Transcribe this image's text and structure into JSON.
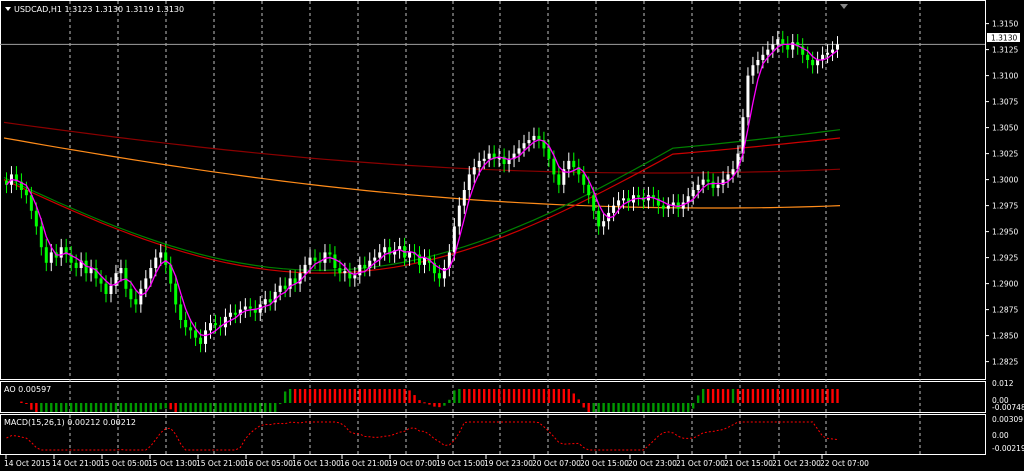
{
  "window": {
    "symbol_line": "USDCAD,H1  1.3123 1.3130 1.3119 1.3130",
    "current_price_label": "1.3130"
  },
  "colors": {
    "background": "#000000",
    "bull_candle": "#ffffff",
    "bear_candle": "#00ff00",
    "fast_ma": "#ff00ff",
    "ma_green": "#008000",
    "ma_red": "#cc0000",
    "ma_darkred": "#8b0000",
    "ma_orange": "#ff8c1a",
    "ao_up": "#009900",
    "ao_down": "#ff0000",
    "macd_signal": "#ff0000",
    "grid": "#c0c0c0"
  },
  "main_price_axis": [
    "1.3150",
    "1.3125",
    "1.3100",
    "1.3075",
    "1.3050",
    "1.3025",
    "1.3000",
    "1.2975",
    "1.2950",
    "1.2925",
    "1.2900",
    "1.2875",
    "1.2850",
    "1.2825"
  ],
  "ao_panel": {
    "label": "AO 0.00597",
    "axis": [
      "0.012",
      "0.00",
      "-0.00748"
    ]
  },
  "macd_panel": {
    "label": "MACD(15,26,1) 0.00212 0.00212",
    "axis": [
      "0.00309",
      "0.00",
      "-0.00219"
    ]
  },
  "time_axis": [
    "14 Oct 2015",
    "14 Oct 21:00",
    "15 Oct 05:00",
    "15 Oct 13:00",
    "15 Oct 21:00",
    "16 Oct 05:00",
    "16 Oct 13:00",
    "16 Oct 21:00",
    "19 Oct 07:00",
    "19 Oct 15:00",
    "19 Oct 23:00",
    "20 Oct 07:00",
    "20 Oct 15:00",
    "20 Oct 23:00",
    "21 Oct 07:00",
    "21 Oct 15:00",
    "21 Oct 23:00",
    "22 Oct 07:00"
  ],
  "chart_data": {
    "type": "candlestick",
    "symbol": "USDCAD",
    "timeframe": "H1",
    "ylim": [
      1.2815,
      1.3165
    ],
    "close_series": [
      1.2995,
      1.3005,
      1.2998,
      1.299,
      1.2985,
      1.297,
      1.2955,
      1.2935,
      1.292,
      1.293,
      1.2925,
      1.2935,
      1.2928,
      1.292,
      1.2915,
      1.2922,
      1.291,
      1.2915,
      1.2905,
      1.29,
      1.289,
      1.2898,
      1.291,
      1.2915,
      1.2895,
      1.2885,
      1.288,
      1.2895,
      1.2905,
      1.2915,
      1.2925,
      1.293,
      1.2918,
      1.29,
      1.288,
      1.2865,
      1.2858,
      1.2855,
      1.2848,
      1.2842,
      1.2855,
      1.2862,
      1.286,
      1.2858,
      1.2868,
      1.2872,
      1.287,
      1.2875,
      1.2878,
      1.2876,
      1.2872,
      1.288,
      1.2885,
      1.2882,
      1.2892,
      1.2898,
      1.2895,
      1.2905,
      1.29,
      1.291,
      1.2918,
      1.2925,
      1.2922,
      1.292,
      1.293,
      1.2928,
      1.2915,
      1.291,
      1.2912,
      1.2905,
      1.2908,
      1.2918,
      1.2915,
      1.2922,
      1.2925,
      1.293,
      1.2935,
      1.2928,
      1.2932,
      1.2936,
      1.2925,
      1.293,
      1.2928,
      1.2918,
      1.2925,
      1.292,
      1.291,
      1.2905,
      1.2915,
      1.293,
      1.2955,
      1.2975,
      1.299,
      1.3005,
      1.3012,
      1.3018,
      1.302,
      1.3025,
      1.302,
      1.3022,
      1.3015,
      1.302,
      1.3025,
      1.303,
      1.3035,
      1.3038,
      1.3042,
      1.3038,
      1.303,
      1.302,
      1.3005,
      1.2995,
      1.301,
      1.3018,
      1.3012,
      1.3005,
      1.2995,
      1.2985,
      1.297,
      1.2955,
      1.296,
      1.2968,
      1.2975,
      1.298,
      1.2982,
      1.2978,
      1.2985,
      1.2983,
      1.298,
      1.2985,
      1.2982,
      1.2975,
      1.2972,
      1.2975,
      1.2978,
      1.2972,
      1.2978,
      1.2984,
      1.299,
      1.2995,
      1.3,
      1.2998,
      1.2992,
      1.2995,
      1.3,
      1.3005,
      1.301,
      1.3025,
      1.306,
      1.31,
      1.311,
      1.3115,
      1.312,
      1.3125,
      1.313,
      1.3135,
      1.313,
      1.3125,
      1.3132,
      1.3128,
      1.312,
      1.3115,
      1.311,
      1.3115,
      1.312,
      1.3122,
      1.3125,
      1.313
    ],
    "moving_averages": [
      {
        "color_key": "ma_darkred",
        "start": 1.3055,
        "end": 1.301
      },
      {
        "color_key": "ma_orange",
        "start": 1.304,
        "end": 1.2975
      },
      {
        "color_key": "ma_red",
        "start": 1.3,
        "end": 1.304
      },
      {
        "color_key": "ma_green",
        "start": 1.3002,
        "end": 1.3048
      }
    ]
  }
}
